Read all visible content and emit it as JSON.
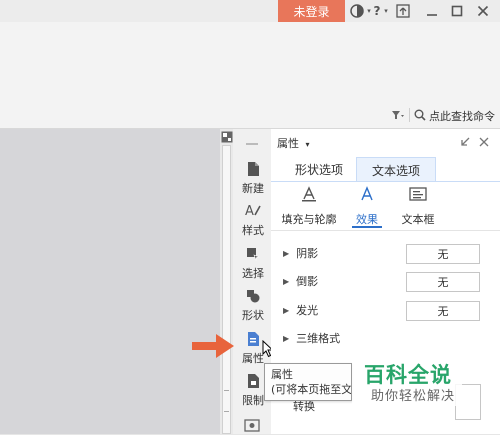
{
  "titlebar": {
    "login_label": "未登录",
    "help_label": "?",
    "login_color": "#e8765a"
  },
  "commandbar": {
    "search_label": "点此查找命令"
  },
  "rail": {
    "items": [
      {
        "label": "新建",
        "icon": "new-doc-icon"
      },
      {
        "label": "样式",
        "icon": "style-icon"
      },
      {
        "label": "选择",
        "icon": "select-icon"
      },
      {
        "label": "形状",
        "icon": "shape-icon"
      },
      {
        "label": "属性",
        "icon": "property-icon"
      },
      {
        "label": "限制",
        "icon": "restrict-icon"
      }
    ]
  },
  "pane": {
    "title": "属性",
    "tabs": [
      "形状选项",
      "文本选项"
    ],
    "active_tab": "文本选项",
    "subtabs": [
      "填充与轮廓",
      "效果",
      "文本框"
    ],
    "active_subtab": "效果",
    "props": [
      {
        "label": "阴影",
        "value": "无"
      },
      {
        "label": "倒影",
        "value": "无"
      },
      {
        "label": "发光",
        "value": "无"
      },
      {
        "label": "三维格式"
      }
    ],
    "convert_label": "转换"
  },
  "tooltip": {
    "title": "属性",
    "desc": "(可将本页拖至文本"
  },
  "watermark": {
    "title": "百科全说",
    "subtitle": "助你轻松解决"
  },
  "colors": {
    "accent": "#2d6fc9",
    "arrow": "#e8643c",
    "watermark": "#28a56a"
  }
}
